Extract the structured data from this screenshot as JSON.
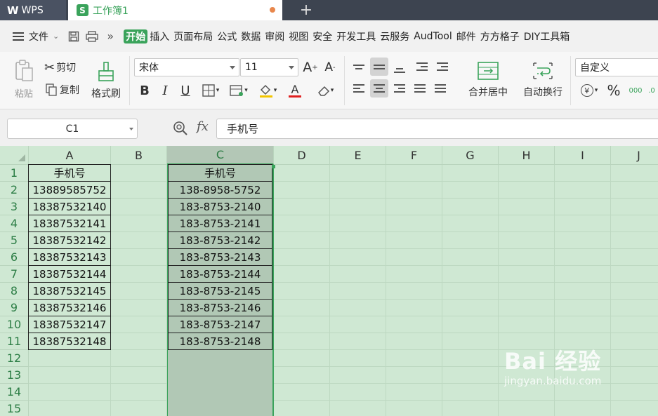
{
  "tabs": {
    "app": "WPS",
    "document": "工作簿1",
    "doc_icon": "S"
  },
  "menu": {
    "file": "文件",
    "items": [
      "开始",
      "插入",
      "页面布局",
      "公式",
      "数据",
      "审阅",
      "视图",
      "安全",
      "开发工具",
      "云服务",
      "AudTool",
      "邮件",
      "方方格子",
      "DIY工具箱"
    ]
  },
  "ribbon": {
    "paste": "粘贴",
    "cut": "剪切",
    "copy": "复制",
    "format_painter": "格式刷",
    "font_name": "宋体",
    "font_size": "11",
    "bold": "B",
    "italic": "I",
    "underline": "U",
    "merge_center": "合并居中",
    "wrap_text": "自动换行",
    "number_format": "自定义",
    "currency": "¥",
    "percent": "%",
    "thousands": "000",
    "font_color_letter": "A",
    "grow_font": "A",
    "shrink_font": "A"
  },
  "formula_bar": {
    "name_box": "C1",
    "fx": "fx",
    "value": "手机号"
  },
  "sheet": {
    "columns": [
      "A",
      "B",
      "C",
      "D",
      "E",
      "F",
      "G",
      "H",
      "I",
      "J"
    ],
    "rows": [
      "1",
      "2",
      "3",
      "4",
      "5",
      "6",
      "7",
      "8",
      "9",
      "10",
      "11",
      "12",
      "13",
      "14",
      "15"
    ],
    "colA": [
      "手机号",
      "13889585752",
      "18387532140",
      "18387532141",
      "18387532142",
      "18387532143",
      "18387532144",
      "18387532145",
      "18387532146",
      "18387532147",
      "18387532148"
    ],
    "colC": [
      "手机号",
      "138-8958-5752",
      "183-8753-2140",
      "183-8753-2141",
      "183-8753-2142",
      "183-8753-2143",
      "183-8753-2144",
      "183-8753-2145",
      "183-8753-2146",
      "183-8753-2147",
      "183-8753-2148"
    ],
    "selected_column": "C"
  },
  "watermark": {
    "logo": "Bai 经验",
    "url": "jingyan.baidu.com"
  },
  "colors": {
    "accent": "#3aa35b",
    "grid_bg": "#cfe8d3",
    "tabbar": "#3d4450"
  }
}
